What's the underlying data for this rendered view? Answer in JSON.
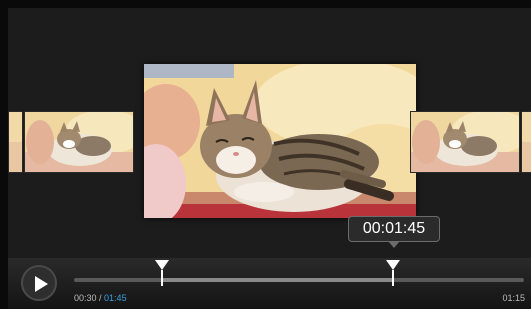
{
  "tooltip": {
    "time": "00:01:45"
  },
  "player": {
    "start_time": "00:30",
    "separator": " / ",
    "current_time": "01:45",
    "end_time": "01:15"
  },
  "icons": {
    "play": "play-icon",
    "trim_start": "trim-start-marker",
    "trim_end": "trim-end-marker"
  },
  "colors": {
    "accent": "#3aa0e0",
    "background": "#1c1c1c",
    "tooltip_bg": "#2b2b2b"
  }
}
